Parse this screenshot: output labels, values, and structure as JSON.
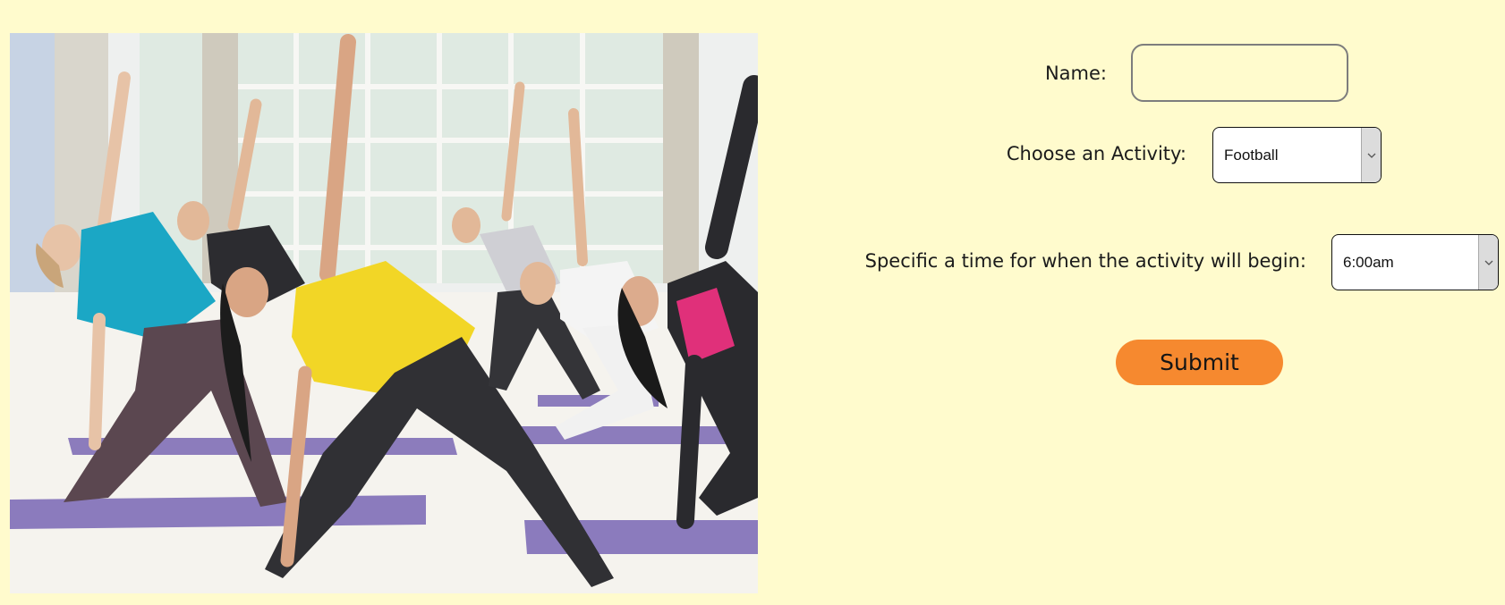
{
  "photo": {
    "description_icon": "yoga-class-photo"
  },
  "form": {
    "name_label": "Name:",
    "name_value": "",
    "name_placeholder": "",
    "activity_label": "Choose an Activity:",
    "activity_selected": "Football",
    "time_label": "Specific a time for when the activity will begin:",
    "time_selected": "6:00am",
    "submit_label": "Submit"
  },
  "colors": {
    "background": "#fffbcd",
    "submit_button": "#f6892f",
    "input_border": "#7d7d7d"
  }
}
